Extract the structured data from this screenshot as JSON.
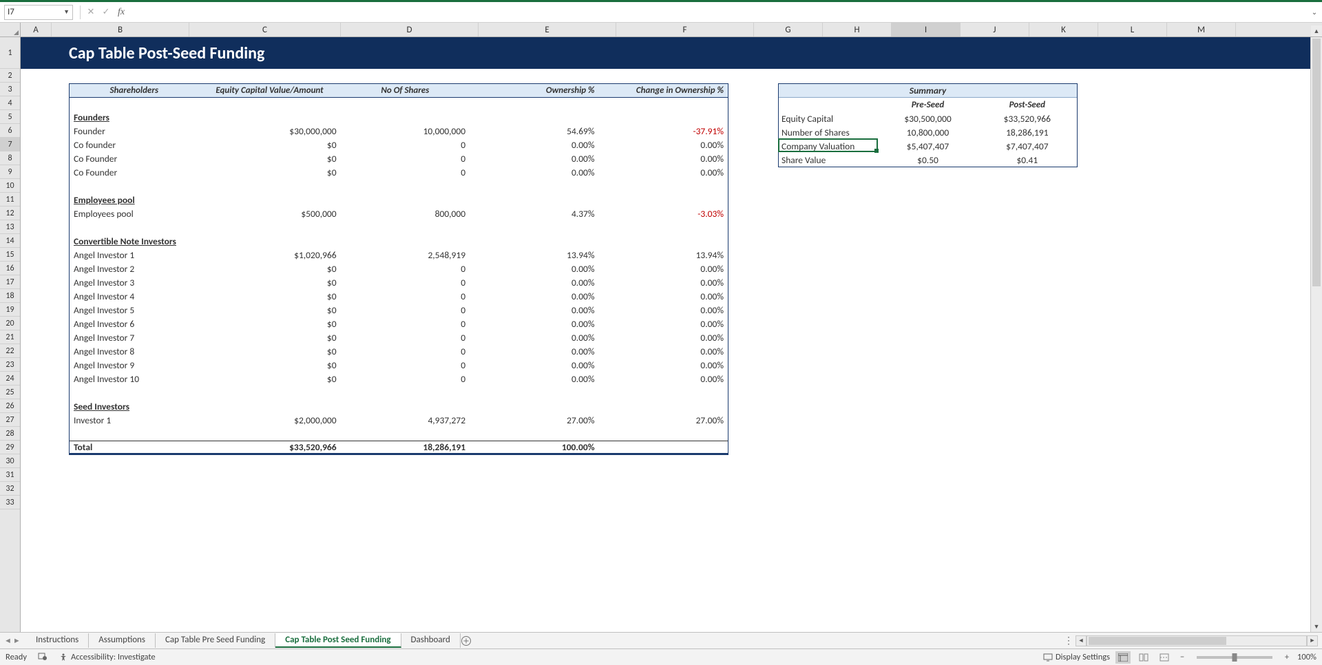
{
  "nameBox": "I7",
  "formulaInput": "",
  "columns": [
    "A",
    "B",
    "C",
    "D",
    "E",
    "F",
    "G",
    "H",
    "I",
    "J",
    "K",
    "L",
    "M"
  ],
  "rowCount": 33,
  "selectedCol": "I",
  "selectedRow": 7,
  "title": "Cap Table Post-Seed Funding",
  "mainTable": {
    "headers": {
      "shareholders": "Shareholders",
      "equity": "Equity Capital Value/Amount",
      "shares": "No Of Shares",
      "ownership": "Ownership %",
      "change": "Change in Ownership %"
    },
    "sections": [
      {
        "title": "Founders",
        "rows": [
          {
            "name": "Founder",
            "equity": "$30,000,000",
            "shares": "10,000,000",
            "own": "54.69%",
            "chg": "-37.91%",
            "neg": true
          },
          {
            "name": "Co founder",
            "equity": "$0",
            "shares": "0",
            "own": "0.00%",
            "chg": "0.00%"
          },
          {
            "name": "Co Founder",
            "equity": "$0",
            "shares": "0",
            "own": "0.00%",
            "chg": "0.00%"
          },
          {
            "name": "Co Founder",
            "equity": "$0",
            "shares": "0",
            "own": "0.00%",
            "chg": "0.00%"
          }
        ]
      },
      {
        "title": "Employees pool",
        "rows": [
          {
            "name": "Employees pool",
            "equity": "$500,000",
            "shares": "800,000",
            "own": "4.37%",
            "chg": "-3.03%",
            "neg": true
          }
        ]
      },
      {
        "title": "Convertible Note Investors",
        "rows": [
          {
            "name": "Angel Investor 1",
            "equity": "$1,020,966",
            "shares": "2,548,919",
            "own": "13.94%",
            "chg": "13.94%"
          },
          {
            "name": "Angel Investor 2",
            "equity": "$0",
            "shares": "0",
            "own": "0.00%",
            "chg": "0.00%"
          },
          {
            "name": "Angel Investor 3",
            "equity": "$0",
            "shares": "0",
            "own": "0.00%",
            "chg": "0.00%"
          },
          {
            "name": "Angel Investor 4",
            "equity": "$0",
            "shares": "0",
            "own": "0.00%",
            "chg": "0.00%"
          },
          {
            "name": "Angel Investor 5",
            "equity": "$0",
            "shares": "0",
            "own": "0.00%",
            "chg": "0.00%"
          },
          {
            "name": "Angel Investor 6",
            "equity": "$0",
            "shares": "0",
            "own": "0.00%",
            "chg": "0.00%"
          },
          {
            "name": "Angel Investor 7",
            "equity": "$0",
            "shares": "0",
            "own": "0.00%",
            "chg": "0.00%"
          },
          {
            "name": "Angel Investor 8",
            "equity": "$0",
            "shares": "0",
            "own": "0.00%",
            "chg": "0.00%"
          },
          {
            "name": "Angel Investor 9",
            "equity": "$0",
            "shares": "0",
            "own": "0.00%",
            "chg": "0.00%"
          },
          {
            "name": "Angel Investor 10",
            "equity": "$0",
            "shares": "0",
            "own": "0.00%",
            "chg": "0.00%"
          }
        ]
      },
      {
        "title": "Seed Investors",
        "rows": [
          {
            "name": "Investor 1",
            "equity": "$2,000,000",
            "shares": "4,937,272",
            "own": "27.00%",
            "chg": "27.00%"
          }
        ]
      }
    ],
    "total": {
      "label": "Total",
      "equity": "$33,520,966",
      "shares": "18,286,191",
      "own": "100.00%",
      "chg": ""
    }
  },
  "summary": {
    "title": "Summary",
    "preLabel": "Pre-Seed",
    "postLabel": "Post-Seed",
    "rows": [
      {
        "label": "Equity Capital",
        "pre": "$30,500,000",
        "post": "$33,520,966"
      },
      {
        "label": "Number of Shares",
        "pre": "10,800,000",
        "post": "18,286,191"
      },
      {
        "label": "Company Valuation",
        "pre": "$5,407,407",
        "post": "$7,407,407"
      },
      {
        "label": "Share Value",
        "pre": "$0.50",
        "post": "$0.41"
      }
    ]
  },
  "tabs": [
    "Instructions",
    "Assumptions",
    "Cap Table Pre Seed Funding",
    "Cap Table Post Seed Funding",
    "Dashboard"
  ],
  "activeTab": 3,
  "status": {
    "ready": "Ready",
    "accessibility": "Accessibility: Investigate",
    "displaySettings": "Display Settings",
    "zoom": "100%"
  }
}
